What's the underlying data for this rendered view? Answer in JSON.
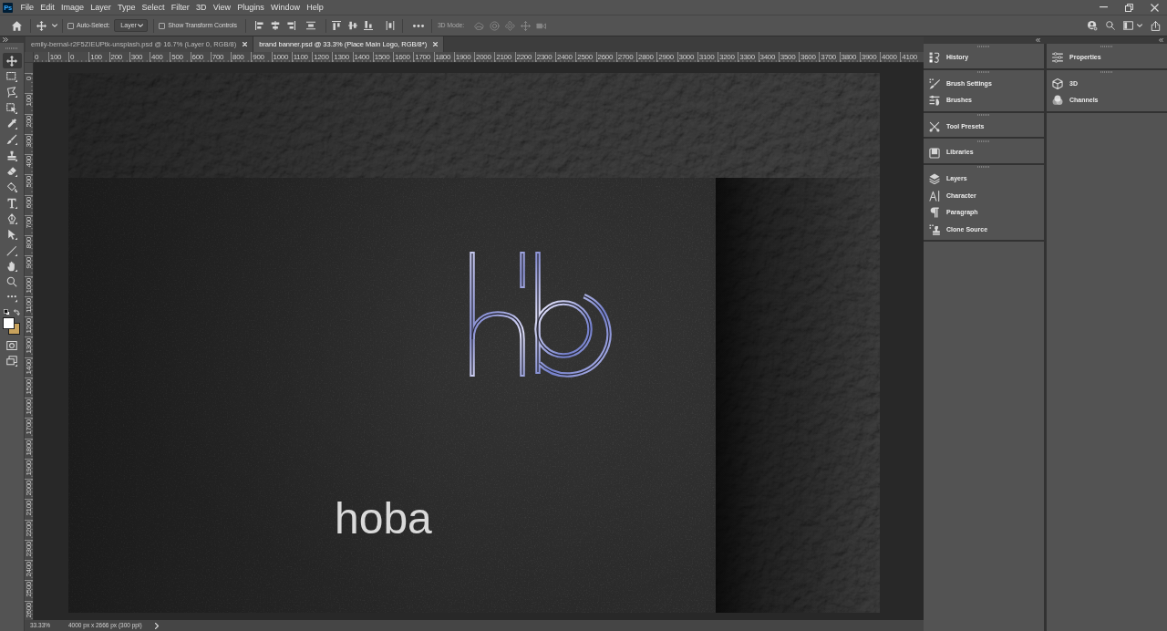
{
  "app_logo": "Ps",
  "menu": [
    "File",
    "Edit",
    "Image",
    "Layer",
    "Type",
    "Select",
    "Filter",
    "3D",
    "View",
    "Plugins",
    "Window",
    "Help"
  ],
  "options_bar": {
    "auto_select": {
      "label": "Auto-Select:",
      "checked": false
    },
    "layer_dropdown": {
      "value": "Layer"
    },
    "transform_controls": {
      "label": "Show Transform Controls",
      "checked": false
    },
    "three_d_mode": {
      "label": "3D Mode:",
      "disabled": true
    }
  },
  "document_tabs": [
    {
      "label": "emily-bernal-r2F5ZIEUPtk-unsplash.psd @ 16.7% (Layer 0, RGB/8)",
      "selected": false
    },
    {
      "label": "brand banner.psd @ 33.3% (Place Main Logo, RGB/8*)",
      "selected": true
    }
  ],
  "toolbar": {
    "tools": [
      {
        "kind": "move",
        "selected": true
      },
      {
        "kind": "marquee",
        "selected": false
      },
      {
        "kind": "lasso",
        "selected": false
      },
      {
        "kind": "objectselect",
        "selected": false
      },
      {
        "kind": "eyedropper",
        "selected": false
      },
      {
        "kind": "brush",
        "selected": false
      },
      {
        "kind": "stamp",
        "selected": false
      },
      {
        "kind": "eraser",
        "selected": false
      },
      {
        "kind": "bucket",
        "selected": false
      },
      {
        "kind": "type",
        "selected": false
      },
      {
        "kind": "pen",
        "selected": false
      },
      {
        "kind": "pathselect",
        "selected": false
      },
      {
        "kind": "line",
        "selected": false
      },
      {
        "kind": "hand",
        "selected": false
      },
      {
        "kind": "zoom",
        "selected": false
      },
      {
        "kind": "more",
        "selected": false
      }
    ],
    "color_swatches": [
      {
        "kind": "foreground",
        "color": "#ffffff"
      },
      {
        "kind": "background",
        "color": "#c8a25c"
      }
    ]
  },
  "rulers": {
    "horizontal": [
      "0",
      "100",
      "0",
      "100",
      "200",
      "300",
      "400",
      "500",
      "600",
      "700",
      "800",
      "900",
      "1000",
      "1100",
      "1200",
      "1300",
      "1400",
      "1500",
      "1600",
      "1700",
      "1800",
      "1900",
      "2000",
      "2100",
      "2200",
      "2300",
      "2400",
      "2500",
      "2600",
      "2700",
      "2800",
      "2900",
      "3000",
      "3100",
      "3200",
      "3300",
      "3400",
      "3500",
      "3600",
      "3700",
      "3800",
      "3900",
      "4000",
      "4100"
    ],
    "vertical": [
      "0",
      "100",
      "200",
      "300",
      "400",
      "500",
      "600",
      "700",
      "800",
      "900",
      "1000",
      "1100",
      "1200",
      "1300",
      "1400",
      "1500",
      "1600",
      "1700",
      "1800",
      "1900",
      "2000",
      "2100",
      "2200",
      "2300",
      "2400",
      "2500",
      "2600"
    ]
  },
  "canvas": {
    "title": "hoba"
  },
  "status_bar": {
    "zoom": "33.33%",
    "document_size": "4000 px x 2666 px (300 ppi)"
  },
  "panel_dock": {
    "columns": [
      {
        "groups": [
          {
            "items": [
              "History"
            ]
          },
          {
            "items": [
              "Brush Settings",
              "Brushes"
            ]
          },
          {
            "items": [
              "Tool Presets"
            ]
          },
          {
            "items": [
              "Libraries"
            ]
          },
          {
            "items": [
              "Layers",
              "Character",
              "Paragraph",
              "Clone Source"
            ]
          }
        ]
      },
      {
        "groups": [
          {
            "items": [
              "Properties"
            ]
          },
          {
            "items": [
              "3D",
              "Channels"
            ]
          }
        ]
      }
    ]
  }
}
